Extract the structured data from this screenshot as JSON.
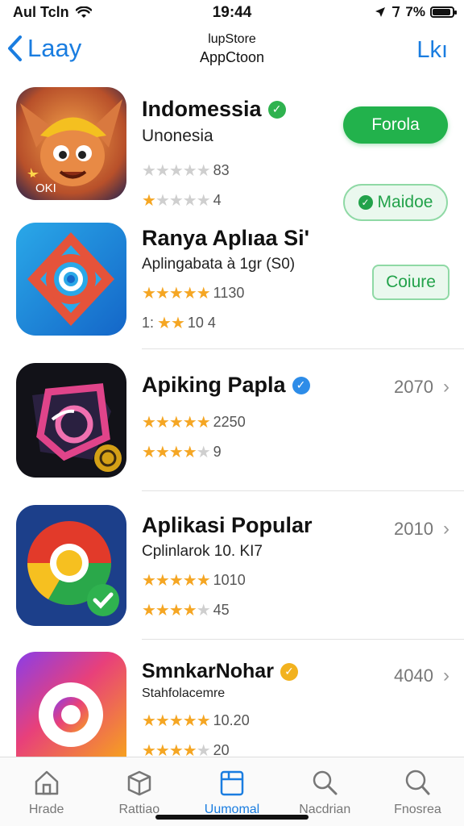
{
  "status_bar": {
    "carrier": "Aul Tcln",
    "time": "19:44",
    "indicators": "7%"
  },
  "nav": {
    "back_label": "Laay",
    "title_line1": "lupStore",
    "title_line2": "AppCtoon",
    "right_label": "Lkı"
  },
  "apps": [
    {
      "name": "Indomessia",
      "subtitle": "Unonesia",
      "rating1_count": "83",
      "rating2_count": "4",
      "button1": "Forola",
      "button2": "Maidoe",
      "icon_caption": "OKI"
    },
    {
      "name": "Ranya Aplıaa Si'",
      "subtitle": "Aplingabata à 1gr (S0)",
      "rating1_count": "1130",
      "rating2_count": "10 4",
      "rating2_prefix": "1:",
      "button1": "Coiure"
    },
    {
      "name": "Apiking Papla",
      "rating1_count": "2250",
      "rating2_count": "9",
      "size": "2070"
    },
    {
      "name": "Aplikasi Popular",
      "subtitle": "Cplinlarok 10. KI7",
      "rating1_count": "1010",
      "rating2_count": "45",
      "size": "2010"
    },
    {
      "name": "SmnkarNohar",
      "subtitle": "Stahfolacemre",
      "rating1_count": "10.20",
      "rating2_count": "20",
      "size": "4040"
    }
  ],
  "tabs": [
    {
      "label": "Hrade",
      "icon": "house-icon"
    },
    {
      "label": "Rattiao",
      "icon": "box-icon"
    },
    {
      "label": "Uumomal",
      "icon": "apps-icon"
    },
    {
      "label": "Nacdrian",
      "icon": "search-icon"
    },
    {
      "label": "Fnosrea",
      "icon": "search-icon"
    }
  ],
  "colors": {
    "accent_blue": "#1a7de0",
    "green": "#22b24c",
    "star": "#f5a623"
  }
}
